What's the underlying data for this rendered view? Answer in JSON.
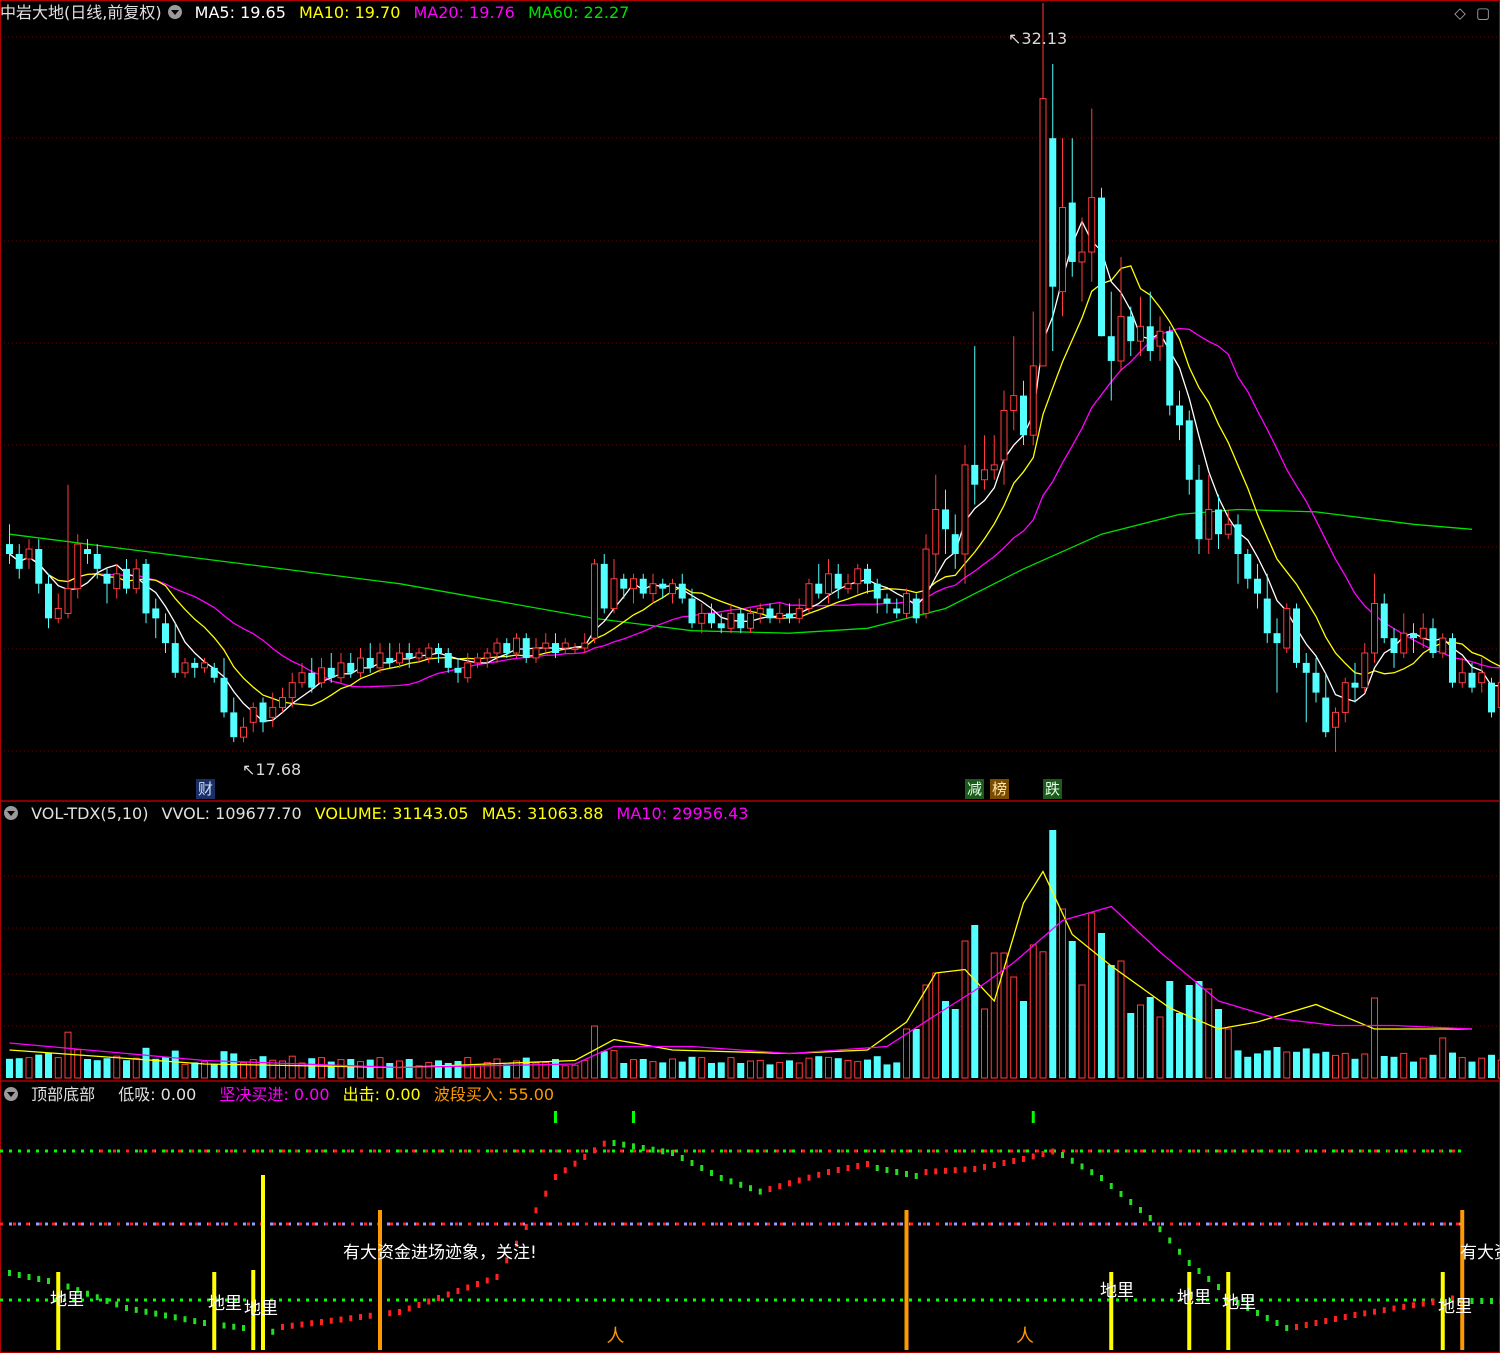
{
  "header": {
    "title": "中岩大地(日线,前复权)",
    "ma5": "MA5: 19.65",
    "ma10": "MA10: 19.70",
    "ma20": "MA20: 19.76",
    "ma60": "MA60: 22.27"
  },
  "top_icons": [
    "diamond-icon",
    "window-icon"
  ],
  "volume_header": {
    "name": "VOL-TDX(5,10)",
    "vvol": "VVOL: 109677.70",
    "volume": "VOLUME: 31143.05",
    "ma5": "MA5: 31063.88",
    "ma10": "MA10: 29956.43"
  },
  "indicator_header": {
    "name": "顶部底部",
    "dixi": "低吸: 0.00",
    "jianjue": "坚决买进: 0.00",
    "chuji": "出击: 0.00",
    "boduan": "波段买入: 55.00"
  },
  "price_labels": {
    "high": "32.13",
    "low": "17.68"
  },
  "tags": {
    "cai": "财",
    "jian": "减",
    "bang": "榜",
    "die": "跌"
  },
  "annotations": {
    "big_money": "有大资金进场迹象，关注!",
    "big_money_cut": "有大资",
    "diguang": "地里"
  },
  "colors": {
    "up": "#ff3b3b",
    "down": "#54ffff",
    "ma5": "#ffffff",
    "ma10": "#ffff00",
    "ma20": "#ff00ff",
    "ma60": "#00e000",
    "grid": "#7a0000",
    "divider": "#b00000"
  },
  "chart_data": {
    "type": "candlestick",
    "candles": [
      [
        21.2,
        21.0,
        21.6,
        20.8
      ],
      [
        21.0,
        20.7,
        21.2,
        20.5
      ],
      [
        20.9,
        21.1,
        21.3,
        20.7
      ],
      [
        21.1,
        20.4,
        21.3,
        20.2
      ],
      [
        20.4,
        19.7,
        20.6,
        19.5
      ],
      [
        19.7,
        19.9,
        20.2,
        19.6
      ],
      [
        19.8,
        20.3,
        22.4,
        19.7
      ],
      [
        20.3,
        21.2,
        21.4,
        20.1
      ],
      [
        21.1,
        21.0,
        21.3,
        20.8
      ],
      [
        21.0,
        20.7,
        21.2,
        20.5
      ],
      [
        20.6,
        20.4,
        20.7,
        20.0
      ],
      [
        20.3,
        20.6,
        20.8,
        20.1
      ],
      [
        20.7,
        20.3,
        20.9,
        20.2
      ],
      [
        20.3,
        20.7,
        20.9,
        20.2
      ],
      [
        20.8,
        19.8,
        20.9,
        19.6
      ],
      [
        19.9,
        19.7,
        20.1,
        19.3
      ],
      [
        19.6,
        19.2,
        19.8,
        19.0
      ],
      [
        19.2,
        18.6,
        19.6,
        18.5
      ],
      [
        18.6,
        18.8,
        18.9,
        18.5
      ],
      [
        18.8,
        18.7,
        18.9,
        18.5
      ],
      [
        18.7,
        18.8,
        18.9,
        18.6
      ],
      [
        18.7,
        18.5,
        18.8,
        18.4
      ],
      [
        18.5,
        17.8,
        18.9,
        17.7
      ],
      [
        17.8,
        17.3,
        18.1,
        17.2
      ],
      [
        17.3,
        17.5,
        17.7,
        17.2
      ],
      [
        17.6,
        17.9,
        18.0,
        17.4
      ],
      [
        18.0,
        17.6,
        18.1,
        17.4
      ],
      [
        17.7,
        17.9,
        18.2,
        17.5
      ],
      [
        17.9,
        18.1,
        18.3,
        17.8
      ],
      [
        18.1,
        18.4,
        18.6,
        17.9
      ],
      [
        18.4,
        18.6,
        18.8,
        18.3
      ],
      [
        18.6,
        18.3,
        18.9,
        18.2
      ],
      [
        18.4,
        18.7,
        18.9,
        18.3
      ],
      [
        18.7,
        18.5,
        19.0,
        18.4
      ],
      [
        18.5,
        18.8,
        19.0,
        18.4
      ],
      [
        18.8,
        18.6,
        19.0,
        18.5
      ],
      [
        18.6,
        18.9,
        19.1,
        18.5
      ],
      [
        18.9,
        18.7,
        19.2,
        18.6
      ],
      [
        18.7,
        19.0,
        19.2,
        18.6
      ],
      [
        18.9,
        18.8,
        19.2,
        18.7
      ],
      [
        18.8,
        19.0,
        19.2,
        18.7
      ],
      [
        19.0,
        18.9,
        19.2,
        18.7
      ],
      [
        18.9,
        19.0,
        19.1,
        18.8
      ],
      [
        18.9,
        19.1,
        19.2,
        18.8
      ],
      [
        19.1,
        19.0,
        19.2,
        18.8
      ],
      [
        19.0,
        18.7,
        19.1,
        18.6
      ],
      [
        18.7,
        18.6,
        18.9,
        18.4
      ],
      [
        18.5,
        18.8,
        19.0,
        18.4
      ],
      [
        18.8,
        18.9,
        19.0,
        18.7
      ],
      [
        18.9,
        19.0,
        19.1,
        18.7
      ],
      [
        19.0,
        19.2,
        19.3,
        18.8
      ],
      [
        19.2,
        19.0,
        19.3,
        18.9
      ],
      [
        19.0,
        19.3,
        19.4,
        18.9
      ],
      [
        19.3,
        18.9,
        19.4,
        18.8
      ],
      [
        18.9,
        19.1,
        19.3,
        18.8
      ],
      [
        19.1,
        19.2,
        19.4,
        19.0
      ],
      [
        19.2,
        19.0,
        19.4,
        18.9
      ],
      [
        19.1,
        19.2,
        19.3,
        19.0
      ],
      [
        19.1,
        19.1,
        19.2,
        19.0
      ],
      [
        19.1,
        19.2,
        19.4,
        19.0
      ],
      [
        19.3,
        20.8,
        20.9,
        19.2
      ],
      [
        20.8,
        19.9,
        21.0,
        19.8
      ],
      [
        19.9,
        20.5,
        20.9,
        19.8
      ],
      [
        20.5,
        20.3,
        20.6,
        20.1
      ],
      [
        20.3,
        20.5,
        20.6,
        20.0
      ],
      [
        20.5,
        20.2,
        20.6,
        20.1
      ],
      [
        20.2,
        20.4,
        20.6,
        20.0
      ],
      [
        20.4,
        20.3,
        20.5,
        20.1
      ],
      [
        20.2,
        20.4,
        20.5,
        20.0
      ],
      [
        20.4,
        20.1,
        20.6,
        20.0
      ],
      [
        20.1,
        19.6,
        20.3,
        19.5
      ],
      [
        19.6,
        19.8,
        20.0,
        19.4
      ],
      [
        19.8,
        19.6,
        20.0,
        19.5
      ],
      [
        19.6,
        19.5,
        19.8,
        19.4
      ],
      [
        19.5,
        19.8,
        20.0,
        19.4
      ],
      [
        19.8,
        19.5,
        19.9,
        19.4
      ],
      [
        19.5,
        19.8,
        19.9,
        19.4
      ],
      [
        19.8,
        19.9,
        20.0,
        19.6
      ],
      [
        19.9,
        19.7,
        20.0,
        19.6
      ],
      [
        19.7,
        19.8,
        20.0,
        19.6
      ],
      [
        19.8,
        19.7,
        20.0,
        19.6
      ],
      [
        19.7,
        19.9,
        20.1,
        19.6
      ],
      [
        19.9,
        20.4,
        20.5,
        19.8
      ],
      [
        20.4,
        20.2,
        20.8,
        20.1
      ],
      [
        20.2,
        20.6,
        20.9,
        20.0
      ],
      [
        20.6,
        20.3,
        20.8,
        20.1
      ],
      [
        20.3,
        20.4,
        20.6,
        20.2
      ],
      [
        20.4,
        20.7,
        20.8,
        20.2
      ],
      [
        20.7,
        20.4,
        20.8,
        20.2
      ],
      [
        20.4,
        20.1,
        20.5,
        19.8
      ],
      [
        20.1,
        20.0,
        20.2,
        19.8
      ],
      [
        19.9,
        19.8,
        20.1,
        19.7
      ],
      [
        19.8,
        20.2,
        20.3,
        19.7
      ],
      [
        20.1,
        19.7,
        20.2,
        19.6
      ],
      [
        19.8,
        21.1,
        21.4,
        19.7
      ],
      [
        21.0,
        21.9,
        22.6,
        20.6
      ],
      [
        21.9,
        21.5,
        22.3,
        21.0
      ],
      [
        21.4,
        21.0,
        21.8,
        20.7
      ],
      [
        21.0,
        22.8,
        23.2,
        20.4
      ],
      [
        22.8,
        22.4,
        25.2,
        22.0
      ],
      [
        22.5,
        22.7,
        23.4,
        22.3
      ],
      [
        22.7,
        22.8,
        23.4,
        22.5
      ],
      [
        22.9,
        23.9,
        24.3,
        22.4
      ],
      [
        23.9,
        24.2,
        25.4,
        23.5
      ],
      [
        24.2,
        23.4,
        24.5,
        23.2
      ],
      [
        23.4,
        24.8,
        25.9,
        23.2
      ],
      [
        24.8,
        30.2,
        32.13,
        29.6
      ],
      [
        29.4,
        26.4,
        30.9,
        25.1
      ],
      [
        26.3,
        28.0,
        29.4,
        25.8
      ],
      [
        28.1,
        26.9,
        29.4,
        26.6
      ],
      [
        26.9,
        27.1,
        27.8,
        26.1
      ],
      [
        27.1,
        28.2,
        30.0,
        26.5
      ],
      [
        28.2,
        25.4,
        28.4,
        25.4
      ],
      [
        25.4,
        24.9,
        26.3,
        24.1
      ],
      [
        24.9,
        25.8,
        27.0,
        24.7
      ],
      [
        25.8,
        25.3,
        26.0,
        25.0
      ],
      [
        25.3,
        25.6,
        26.2,
        25.0
      ],
      [
        25.6,
        25.1,
        26.3,
        24.9
      ],
      [
        25.2,
        25.5,
        25.8,
        24.9
      ],
      [
        25.5,
        24.0,
        25.6,
        23.8
      ],
      [
        24.0,
        23.6,
        24.3,
        23.3
      ],
      [
        23.7,
        22.5,
        23.9,
        22.2
      ],
      [
        22.5,
        21.3,
        22.8,
        21.0
      ],
      [
        21.3,
        21.9,
        22.6,
        21.0
      ],
      [
        21.9,
        21.4,
        22.2,
        21.1
      ],
      [
        21.4,
        21.6,
        21.9,
        21.3
      ],
      [
        21.6,
        21.0,
        21.8,
        20.4
      ],
      [
        21.0,
        20.5,
        21.1,
        20.3
      ],
      [
        20.5,
        20.2,
        20.8,
        19.9
      ],
      [
        20.1,
        19.4,
        20.6,
        19.2
      ],
      [
        19.4,
        19.2,
        19.7,
        18.2
      ],
      [
        19.1,
        19.9,
        20.0,
        19.0
      ],
      [
        19.9,
        18.8,
        20.0,
        18.7
      ],
      [
        18.8,
        18.6,
        19.0,
        17.6
      ],
      [
        18.6,
        18.2,
        18.9,
        18.0
      ],
      [
        18.1,
        17.4,
        18.6,
        17.3
      ],
      [
        17.5,
        17.8,
        17.9,
        17.0
      ],
      [
        17.8,
        18.4,
        18.5,
        17.6
      ],
      [
        18.4,
        18.3,
        18.8,
        18.0
      ],
      [
        18.3,
        19.0,
        19.2,
        18.2
      ],
      [
        19.0,
        20.0,
        20.6,
        18.8
      ],
      [
        20.0,
        19.3,
        20.2,
        19.2
      ],
      [
        19.3,
        19.0,
        19.5,
        18.7
      ],
      [
        19.0,
        19.4,
        19.8,
        18.9
      ],
      [
        19.4,
        19.3,
        19.6,
        19.0
      ],
      [
        19.3,
        19.5,
        19.8,
        19.1
      ],
      [
        19.5,
        19.0,
        19.7,
        18.9
      ],
      [
        19.0,
        19.3,
        19.4,
        18.9
      ],
      [
        19.3,
        18.4,
        19.4,
        18.3
      ],
      [
        18.4,
        18.6,
        18.9,
        18.3
      ],
      [
        18.6,
        18.3,
        18.8,
        18.2
      ],
      [
        18.4,
        18.6,
        18.9,
        18.2
      ],
      [
        18.4,
        17.8,
        18.5,
        17.7
      ],
      [
        17.9,
        18.4,
        18.5,
        17.8
      ],
      [
        18.2,
        18.3,
        18.5,
        18.0
      ],
      [
        18.3,
        20.1,
        20.1,
        18.2
      ]
    ],
    "ma60_curve": [
      [
        0,
        21.4
      ],
      [
        20,
        20.9
      ],
      [
        40,
        20.4
      ],
      [
        60,
        19.7
      ],
      [
        70,
        19.45
      ],
      [
        80,
        19.4
      ],
      [
        88,
        19.5
      ],
      [
        96,
        19.9
      ],
      [
        104,
        20.7
      ],
      [
        112,
        21.4
      ],
      [
        120,
        21.8
      ],
      [
        126,
        21.9
      ],
      [
        134,
        21.85
      ],
      [
        144,
        21.6
      ],
      [
        150,
        21.5
      ]
    ],
    "volume_ma5_curve": [
      [
        0,
        0.08
      ],
      [
        20,
        0.04
      ],
      [
        40,
        0.03
      ],
      [
        58,
        0.05
      ],
      [
        62,
        0.11
      ],
      [
        68,
        0.08
      ],
      [
        80,
        0.07
      ],
      [
        88,
        0.08
      ],
      [
        92,
        0.16
      ],
      [
        95,
        0.3
      ],
      [
        98,
        0.31
      ],
      [
        101,
        0.22
      ],
      [
        104,
        0.5
      ],
      [
        106,
        0.59
      ],
      [
        109,
        0.41
      ],
      [
        113,
        0.32
      ],
      [
        119,
        0.2
      ],
      [
        124,
        0.14
      ],
      [
        128,
        0.16
      ],
      [
        134,
        0.21
      ],
      [
        140,
        0.14
      ],
      [
        150,
        0.14
      ]
    ],
    "volume_ma10_curve": [
      [
        0,
        0.1
      ],
      [
        20,
        0.05
      ],
      [
        40,
        0.03
      ],
      [
        58,
        0.04
      ],
      [
        62,
        0.09
      ],
      [
        70,
        0.09
      ],
      [
        80,
        0.07
      ],
      [
        90,
        0.09
      ],
      [
        95,
        0.18
      ],
      [
        99,
        0.25
      ],
      [
        103,
        0.33
      ],
      [
        108,
        0.45
      ],
      [
        113,
        0.49
      ],
      [
        118,
        0.36
      ],
      [
        124,
        0.22
      ],
      [
        130,
        0.17
      ],
      [
        136,
        0.15
      ],
      [
        142,
        0.15
      ],
      [
        150,
        0.14
      ]
    ]
  }
}
